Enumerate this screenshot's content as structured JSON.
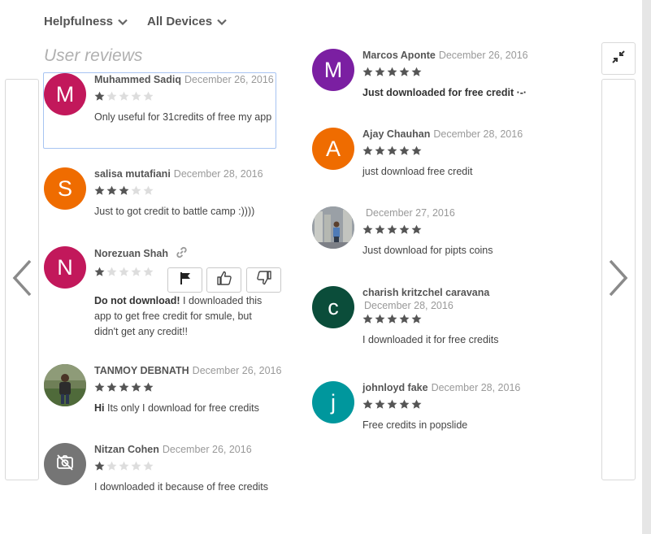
{
  "filters": {
    "sort_label": "Helpfulness",
    "device_label": "All Devices"
  },
  "section_title": "User reviews",
  "reviews": [
    {
      "author": "Muhammed Sadiq",
      "date": "December 26, 2016",
      "rating": 1,
      "avatar_letter": "M",
      "avatar_color": "#c2185b",
      "text": "Only useful for 31credits of free my app"
    },
    {
      "author": "salisa mutafiani",
      "date": "December 28, 2016",
      "rating": 3,
      "avatar_letter": "S",
      "avatar_color": "#ef6c00",
      "text": "Just to got credit to battle camp :))))"
    },
    {
      "author": "Norezuan Shah",
      "date": "",
      "rating": 1,
      "avatar_letter": "N",
      "avatar_color": "#c2185b",
      "text_bold": "Do not download!",
      "text": " I downloaded this app to get free credit for smule, but didn't get any credit!!"
    },
    {
      "author": "TANMOY DEBNATH",
      "date": "December 26, 2016",
      "rating": 5,
      "avatar_letter": "",
      "avatar_color": "#5d6b4e",
      "text_bold": "Hi",
      "text": " Its only I download for free credits"
    },
    {
      "author": "Nitzan Cohen",
      "date": "December 26, 2016",
      "rating": 1,
      "avatar_letter": "",
      "avatar_color": "#757575",
      "text": "I downloaded it because of free credits"
    },
    {
      "author": "Marcos Aponte",
      "date": "December 26, 2016",
      "rating": 5,
      "avatar_letter": "M",
      "avatar_color": "#7b1fa2",
      "text_bold": "Just downloaded for free credit ·-·",
      "text": ""
    },
    {
      "author": "Ajay Chauhan",
      "date": "December 28, 2016",
      "rating": 5,
      "avatar_letter": "A",
      "avatar_color": "#ef6c00",
      "text": "just download free credit"
    },
    {
      "author": "",
      "date": "December 27, 2016",
      "rating": 5,
      "avatar_letter": "",
      "avatar_color": "#8a9098",
      "text": "Just download for pipts coins"
    },
    {
      "author": "charish kritzchel caravana",
      "date": "December 28, 2016",
      "rating": 5,
      "avatar_letter": "c",
      "avatar_color": "#0b4d3a",
      "text": "I downloaded it for free credits"
    },
    {
      "author": "johnloyd fake",
      "date": "December 28, 2016",
      "rating": 5,
      "avatar_letter": "j",
      "avatar_color": "#00979d",
      "text": "Free credits in popslide"
    }
  ],
  "colors": {
    "star_filled": "#555555",
    "star_empty": "#dddddd",
    "selection_border": "#a7c4f2"
  },
  "icons": [
    "chevron-down-icon",
    "flag-icon",
    "thumbs-up-icon",
    "thumbs-down-icon",
    "permalink-icon",
    "collapse-icon",
    "chevron-left-icon",
    "chevron-right-icon",
    "no-photo-icon"
  ]
}
